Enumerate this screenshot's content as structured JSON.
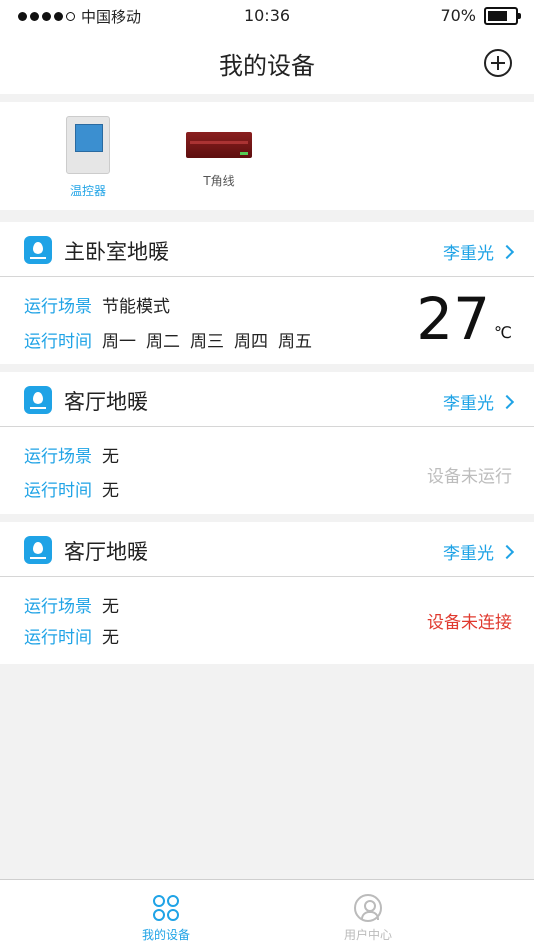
{
  "statusbar": {
    "carrier": "中国移动",
    "time": "10:36",
    "battery": "70%"
  },
  "navbar": {
    "title": "我的设备"
  },
  "device_types": [
    {
      "label": "温控器",
      "color": "#1fa3e6"
    },
    {
      "label": "T角线",
      "color": "#555555"
    }
  ],
  "cards": [
    {
      "name": "主卧室地暖",
      "owner": "李重光",
      "scene_label": "运行场景",
      "scene_value": "节能模式",
      "time_label": "运行时间",
      "days": [
        "周一",
        "周二",
        "周三",
        "周四",
        "周五"
      ],
      "temperature": "27",
      "unit": "℃"
    },
    {
      "name": "客厅地暖",
      "owner": "李重光",
      "scene_label": "运行场景",
      "scene_value": "无",
      "time_label": "运行时间",
      "time_value": "无",
      "status": "设备未运行"
    },
    {
      "name": "客厅地暖",
      "owner": "李重光",
      "scene_label": "运行场景",
      "scene_value": "无",
      "time_label": "运行时间",
      "time_value": "无",
      "status": "设备未连接"
    }
  ],
  "tabbar": {
    "tabs": [
      {
        "label": "我的设备",
        "active": true
      },
      {
        "label": "用户中心",
        "active": false
      }
    ]
  },
  "colors": {
    "accent": "#1fa3e6",
    "error": "#e03a2f",
    "muted": "#bdbdbd"
  }
}
